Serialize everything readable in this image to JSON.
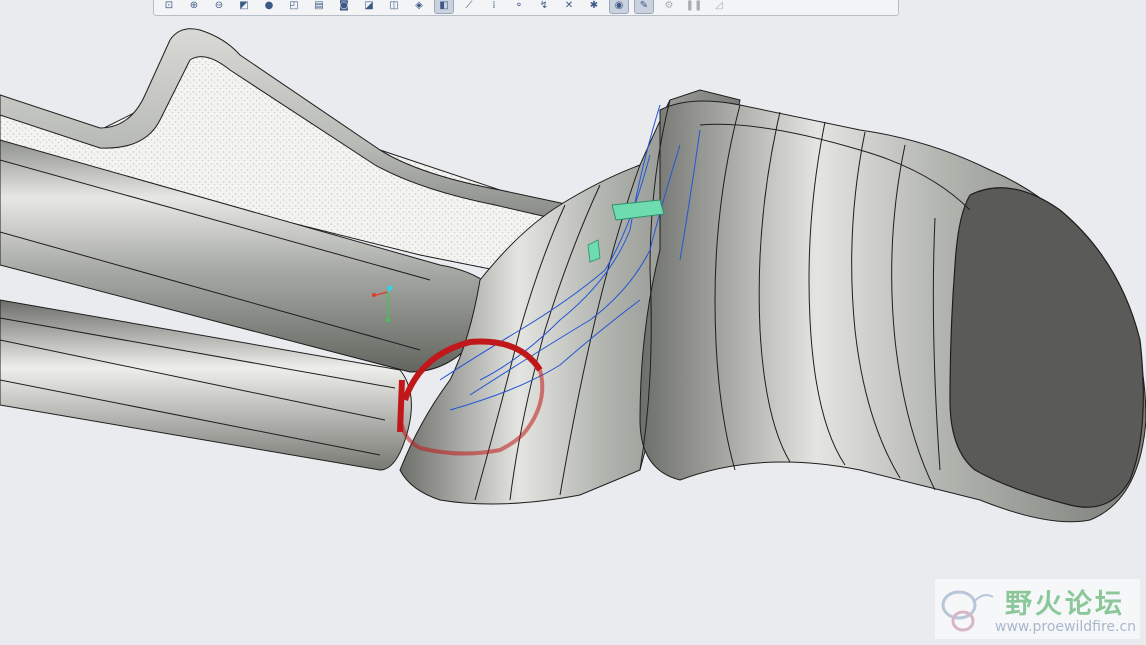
{
  "toolbar": {
    "buttons": [
      {
        "name": "zoom-refit-icon",
        "glyph": "⊡"
      },
      {
        "name": "zoom-in-icon",
        "glyph": "⊕"
      },
      {
        "name": "zoom-out-icon",
        "glyph": "⊖"
      },
      {
        "name": "repaint-icon",
        "glyph": "◩"
      },
      {
        "name": "spin-center-icon",
        "glyph": "●"
      },
      {
        "name": "saved-orientations-icon",
        "glyph": "◰"
      },
      {
        "name": "view-manager-icon",
        "glyph": "▤"
      },
      {
        "name": "named-views-icon",
        "glyph": "◙"
      },
      {
        "name": "perspective-icon",
        "glyph": "◪"
      },
      {
        "name": "display-style-icon",
        "glyph": "◫"
      },
      {
        "name": "shaded-edges-icon",
        "glyph": "◈"
      },
      {
        "name": "sketch-view-icon",
        "glyph": "◧",
        "active": true
      },
      {
        "name": "datum-planes-icon",
        "glyph": "⟋"
      },
      {
        "name": "datum-axes-icon",
        "glyph": "⁞"
      },
      {
        "name": "point-display-icon",
        "glyph": "⚬"
      },
      {
        "name": "csys-display-icon",
        "glyph": "↯"
      },
      {
        "name": "annotation-display-icon",
        "glyph": "✕"
      },
      {
        "name": "spin-center-display-icon",
        "glyph": "✱"
      },
      {
        "name": "show-hidden-icon",
        "glyph": "◉",
        "active": true
      },
      {
        "name": "measure-icon",
        "glyph": "✎",
        "active": true
      },
      {
        "name": "appearance-icon",
        "glyph": "⚙",
        "disabled": true
      },
      {
        "name": "pause-icon",
        "glyph": "❚❚",
        "disabled": true
      },
      {
        "name": "scene-icon",
        "glyph": "◿",
        "disabled": true
      }
    ]
  },
  "watermark": {
    "title": "野火论坛",
    "url": "www.proewildfire.cn"
  },
  "colors": {
    "background": "#e9ebee",
    "part_metal": "#a8aba6",
    "selection_highlight": "#c0181a",
    "edge_preview": "#2356d6",
    "selected_surface": "#6fdcb0",
    "csys_x": "#e03a2b",
    "csys_y": "#3cc94f",
    "csys_z": "#2fd7e6"
  }
}
